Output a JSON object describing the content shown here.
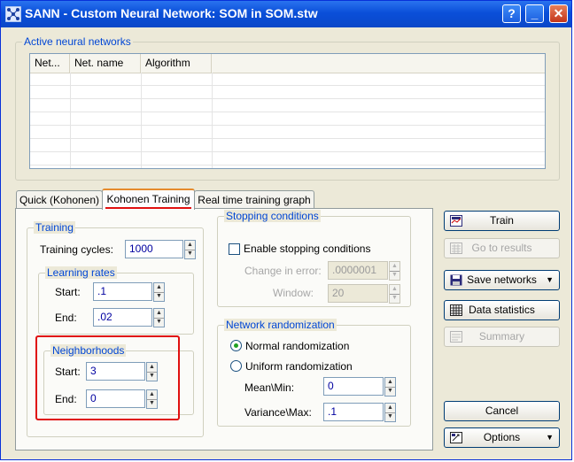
{
  "window": {
    "title": "SANN - Custom Neural Network: SOM in SOM.stw",
    "help_label": "?",
    "minimize_label": "_",
    "close_label": "✕"
  },
  "active_networks": {
    "label": "Active neural networks",
    "columns": [
      "Net...",
      "Net. name",
      "Algorithm"
    ]
  },
  "tabs": [
    {
      "label": "Quick (Kohonen)",
      "active": false
    },
    {
      "label": "Kohonen Training",
      "active": true
    },
    {
      "label": "Real time training graph",
      "active": false
    }
  ],
  "training": {
    "label": "Training",
    "cycles_label": "Training cycles:",
    "cycles_value": "1000",
    "learning_rates": {
      "label": "Learning rates",
      "start_label": "Start:",
      "start_value": ".1",
      "end_label": "End:",
      "end_value": ".02"
    },
    "neighborhoods": {
      "label": "Neighborhoods",
      "start_label": "Start:",
      "start_value": "3",
      "end_label": "End:",
      "end_value": "0"
    }
  },
  "stopping": {
    "label": "Stopping conditions",
    "enable_label": "Enable stopping conditions",
    "enabled": false,
    "change_label": "Change in error:",
    "change_value": ".0000001",
    "window_label": "Window:",
    "window_value": "20"
  },
  "randomization": {
    "label": "Network randomization",
    "normal_label": "Normal randomization",
    "uniform_label": "Uniform randomization",
    "selected": "normal",
    "mean_label": "Mean\\Min:",
    "mean_value": "0",
    "variance_label": "Variance\\Max:",
    "variance_value": ".1"
  },
  "buttons": {
    "train": "Train",
    "go_to_results": "Go to results",
    "save_networks": "Save networks",
    "data_statistics": "Data statistics",
    "summary": "Summary",
    "cancel": "Cancel",
    "options": "Options"
  },
  "icons": {
    "app": "network-app-icon",
    "train": "train-icon",
    "results": "results-icon",
    "save": "floppy-disk-icon",
    "statistics": "statistics-grid-icon",
    "summary": "summary-icon",
    "options": "options-icon"
  },
  "colors": {
    "group_label": "#0046d5",
    "highlight": "#e01010",
    "titlebar": "#0a4fd9"
  }
}
